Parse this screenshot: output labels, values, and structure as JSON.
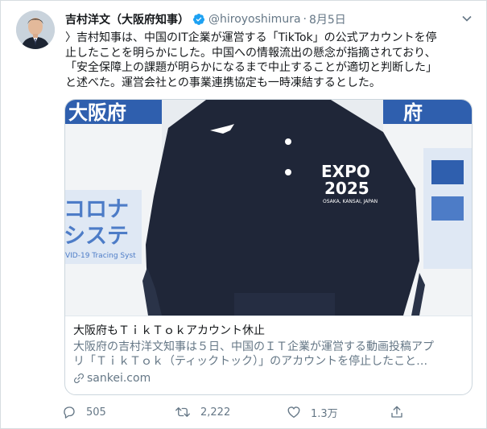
{
  "tweet": {
    "author_name": "吉村洋文（大阪府知事）",
    "handle": "@hiroyoshimura",
    "separator": "·",
    "date": "8月5日",
    "text_lines": [
      "〉吉村知事は、中国のIT企業が運営する「TikTok」の公式アカウントを停",
      "止したことを明らかにした。中国への情報流出の懸念が指摘されており、",
      "「安全保障上の課題が明らかになるまで中止することが適切と判断した」",
      "と述べた。運営会社との事業連携協定も一時凍結するとした。"
    ]
  },
  "card": {
    "image": {
      "banner_text_top": "大阪府",
      "banner_text_left": "コロナ\nシステ",
      "banner_small": "VID-19 Tracing Syst",
      "expo_logo": "EXPO\n2025",
      "expo_sub": "OSAKA, KANSAI, JAPAN"
    },
    "title": "大阪府もＴｉｋＴｏｋアカウント休止",
    "description": "大阪府の吉村洋文知事は５日、中国のＩＴ企業が運営する動画投稿アプ\nリ「ＴｉｋＴｏｋ（ティックトック）」のアカウントを停止したこと…",
    "domain": "sankei.com"
  },
  "actions": {
    "reply_count": "505",
    "retweet_count": "2,222",
    "like_count": "1.3万"
  },
  "colors": {
    "accent": "#1da1f2",
    "secondary_text": "#657786",
    "primary_text": "#14171a",
    "card_border": "#ccd6dd"
  }
}
